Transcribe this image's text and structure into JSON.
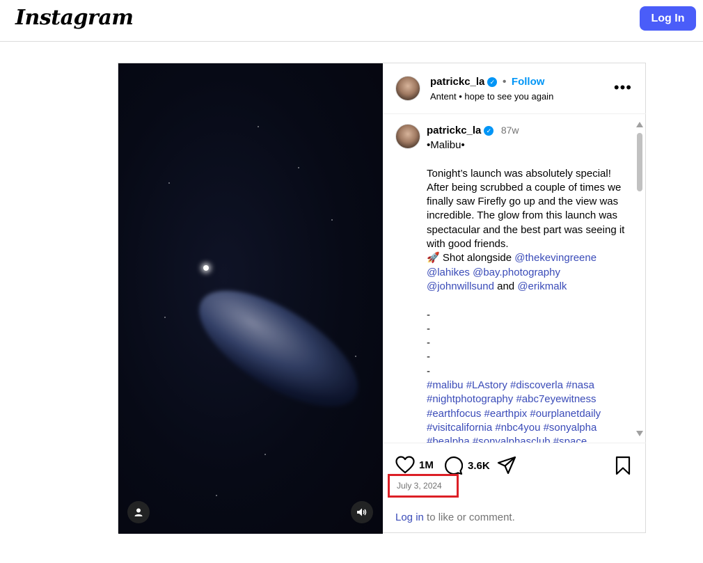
{
  "topbar": {
    "logo": "Instagram",
    "login_label": "Log In"
  },
  "post": {
    "header": {
      "username": "patrickc_la",
      "separator": "•",
      "follow_label": "Follow",
      "subtitle": "Antent • hope to see you again",
      "more_label": "•••"
    },
    "caption": {
      "username": "patrickc_la",
      "time_ago": "87w",
      "location_line": "•Malibu•",
      "para1": "Tonight’s launch was absolutely special! After being scrubbed a couple of times we finally saw Firefly go up and the view was incredible. The glow from this launch was spectacular and the best part was seeing it with good friends.",
      "shot_prefix": "🚀 Shot alongside ",
      "mentions": [
        "@thekevingreene",
        "@lahikes",
        "@bay.photography",
        "@johnwillsund"
      ],
      "and_text": " and ",
      "last_mention": "@erikmalk",
      "dashes": [
        "-",
        "-",
        "-",
        "-",
        "-"
      ],
      "hashtags": "#malibu #LAstory #discoverla #nasa #nightphotography #abc7eyewitness #earthfocus #earthpix #ourplanetdaily #visitcalifornia #nbc4you #sonyalpha #bealpha #sonyalphasclub #space"
    },
    "actions": {
      "likes": "1M",
      "comments": "3.6K"
    },
    "date": "July 3, 2024",
    "login_link": "Log in",
    "login_suffix": " to like or comment."
  },
  "colors": {
    "brand_blue": "#4a5df9",
    "follow_blue": "#0095f6",
    "link": "#3a4bb8",
    "highlight_box": "#dc1f26"
  },
  "icons": [
    "heart-icon",
    "comment-icon",
    "share-icon",
    "bookmark-icon",
    "user-tag-icon",
    "speaker-icon",
    "verified-badge-icon"
  ]
}
